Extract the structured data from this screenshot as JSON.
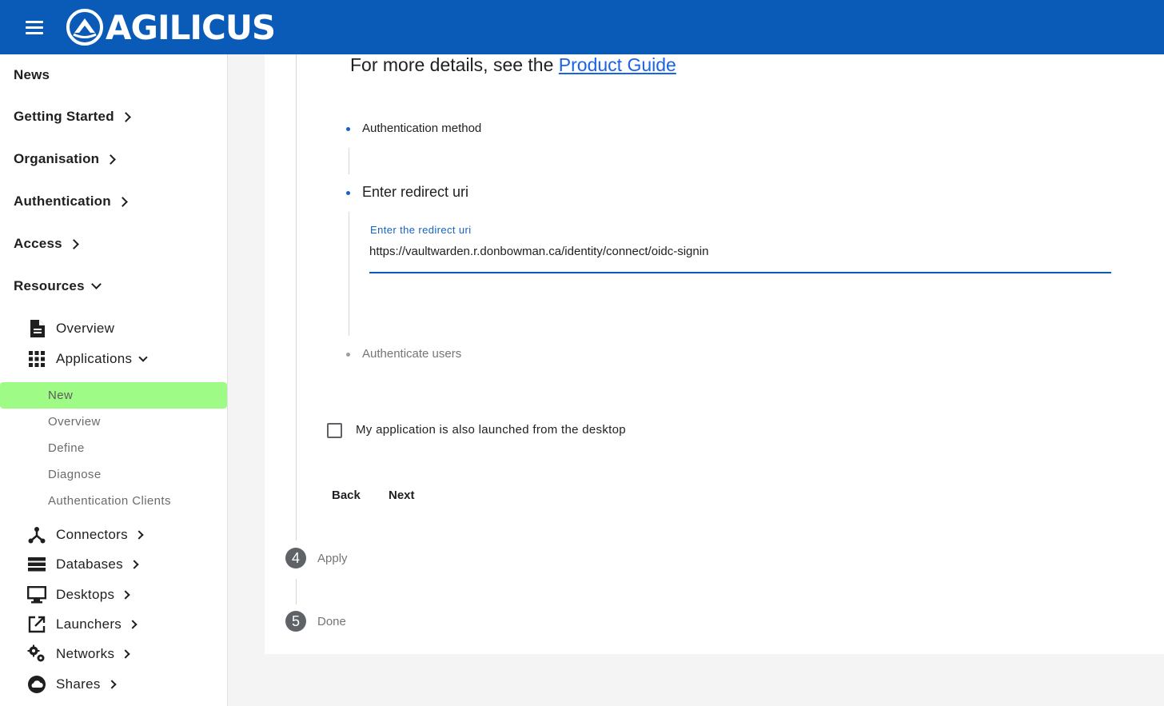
{
  "header": {
    "brand": "AGILICUS",
    "menu_icon": "hamburger-menu-icon",
    "background_color": "#0a5ab8"
  },
  "sidebar": {
    "top_items": [
      {
        "label": "News",
        "has_chevron": false
      },
      {
        "label": "Getting Started",
        "has_chevron": true
      },
      {
        "label": "Organisation",
        "has_chevron": true
      },
      {
        "label": "Authentication",
        "has_chevron": true
      },
      {
        "label": "Access",
        "has_chevron": true
      },
      {
        "label": "Resources",
        "has_chevron": true,
        "expanded": true
      }
    ],
    "resources": {
      "overview": {
        "label": "Overview",
        "icon": "document-icon"
      },
      "applications": {
        "label": "Applications",
        "icon": "grid-icon",
        "expanded": true
      },
      "application_items": [
        {
          "label": "New",
          "active": true
        },
        {
          "label": "Overview"
        },
        {
          "label": "Define"
        },
        {
          "label": "Diagnose"
        },
        {
          "label": "Authentication Clients"
        }
      ],
      "more": [
        {
          "label": "Connectors",
          "icon": "connectors-icon"
        },
        {
          "label": "Databases",
          "icon": "database-icon"
        },
        {
          "label": "Desktops",
          "icon": "monitor-icon"
        },
        {
          "label": "Launchers",
          "icon": "launch-icon"
        },
        {
          "label": "Networks",
          "icon": "gears-icon"
        },
        {
          "label": "Shares",
          "icon": "cloud-icon"
        }
      ]
    },
    "active_color": "#9efc86"
  },
  "main": {
    "details_prefix": "For more details, see the ",
    "details_link": "Product Guide",
    "substeps": [
      {
        "label": "Authentication method",
        "state": "done"
      },
      {
        "label": "Enter redirect uri",
        "state": "active"
      },
      {
        "label": "Authenticate users",
        "state": "pending"
      }
    ],
    "redirect_field": {
      "label": "Enter the redirect uri",
      "value": "https://vaultwarden.r.donbowman.ca/identity/connect/oidc-signin"
    },
    "desktop_checkbox": {
      "label": "My application is also launched from the desktop",
      "checked": false
    },
    "buttons": {
      "back": "Back",
      "next": "Next"
    },
    "steps": [
      {
        "number": "4",
        "label": "Apply"
      },
      {
        "number": "5",
        "label": "Done"
      }
    ]
  }
}
